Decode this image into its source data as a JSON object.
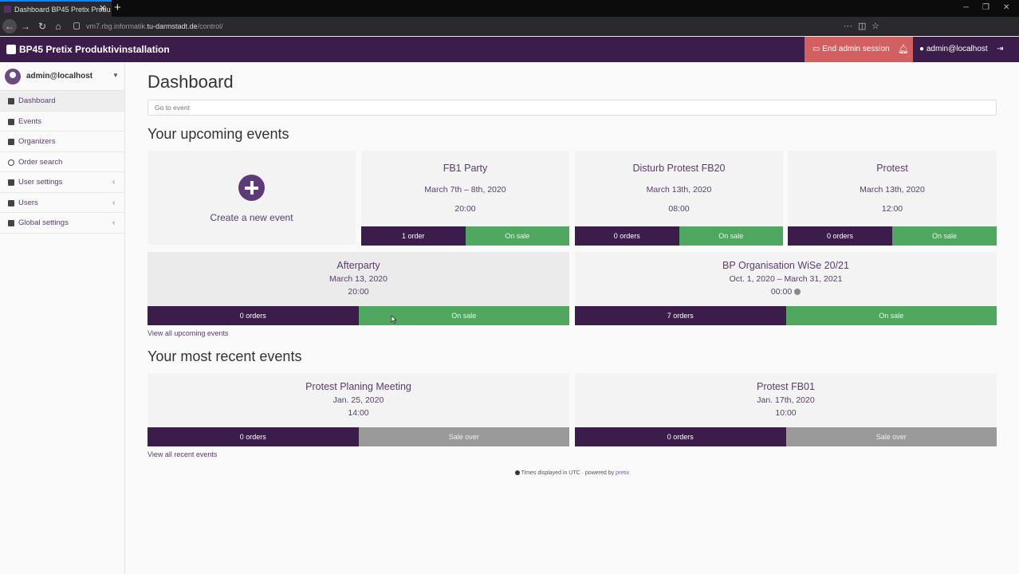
{
  "browser": {
    "tab_title": "Dashboard BP45 Pretix Produ",
    "url_pre": "vm7.rbg.informatik.",
    "url_host": "tu-darmstadt.de",
    "url_path": "/control/"
  },
  "header": {
    "brand": "BP45 Pretix Produktivinstallation",
    "end_admin": "End admin session",
    "user": "admin@localhost"
  },
  "sidebar": {
    "username": "admin@localhost",
    "items": [
      {
        "label": "Dashboard",
        "icon": "dashboard-icon"
      },
      {
        "label": "Events",
        "icon": "calendar-icon"
      },
      {
        "label": "Organizers",
        "icon": "users-icon"
      },
      {
        "label": "Order search",
        "icon": "search-icon"
      },
      {
        "label": "User settings",
        "icon": "user-icon"
      },
      {
        "label": "Users",
        "icon": "user-icon"
      },
      {
        "label": "Global settings",
        "icon": "wrench-icon"
      }
    ]
  },
  "main": {
    "title": "Dashboard",
    "goto_placeholder": "Go to event",
    "upcoming_heading": "Your upcoming events",
    "create_label": "Create a new event",
    "upcoming": [
      {
        "name": "FB1 Party",
        "date": "March 7th – 8th, 2020",
        "time": "20:00",
        "orders": "1 order",
        "status": "On sale"
      },
      {
        "name": "Disturb Protest FB20",
        "date": "March 13th, 2020",
        "time": "08:00",
        "orders": "0 orders",
        "status": "On sale"
      },
      {
        "name": "Protest",
        "date": "March 13th, 2020",
        "time": "12:00",
        "orders": "0 orders",
        "status": "On sale"
      },
      {
        "name": "Afterparty",
        "date": "March 13, 2020",
        "time": "20:00",
        "orders": "0 orders",
        "status": "On sale"
      },
      {
        "name": "BP Organisation WiSe 20/21",
        "date": "Oct. 1, 2020 – March 31, 2021",
        "time": "00:00",
        "orders": "7 orders",
        "status": "On sale"
      }
    ],
    "view_all_upcoming": "View all upcoming events",
    "recent_heading": "Your most recent events",
    "recent": [
      {
        "name": "Protest Planing Meeting",
        "date": "Jan. 25, 2020",
        "time": "14:00",
        "orders": "0 orders",
        "status": "Sale over"
      },
      {
        "name": "Protest FB01",
        "date": "Jan. 17th, 2020",
        "time": "10:00",
        "orders": "0 orders",
        "status": "Sale over"
      }
    ],
    "view_all_recent": "View all recent events",
    "footer_text": "Times displayed in UTC · powered by ",
    "footer_link": "pretix"
  },
  "colors": {
    "primary": "#3b1c4a",
    "on_sale": "#50a860",
    "sale_over": "#9a9a9a",
    "danger": "#d36060"
  }
}
